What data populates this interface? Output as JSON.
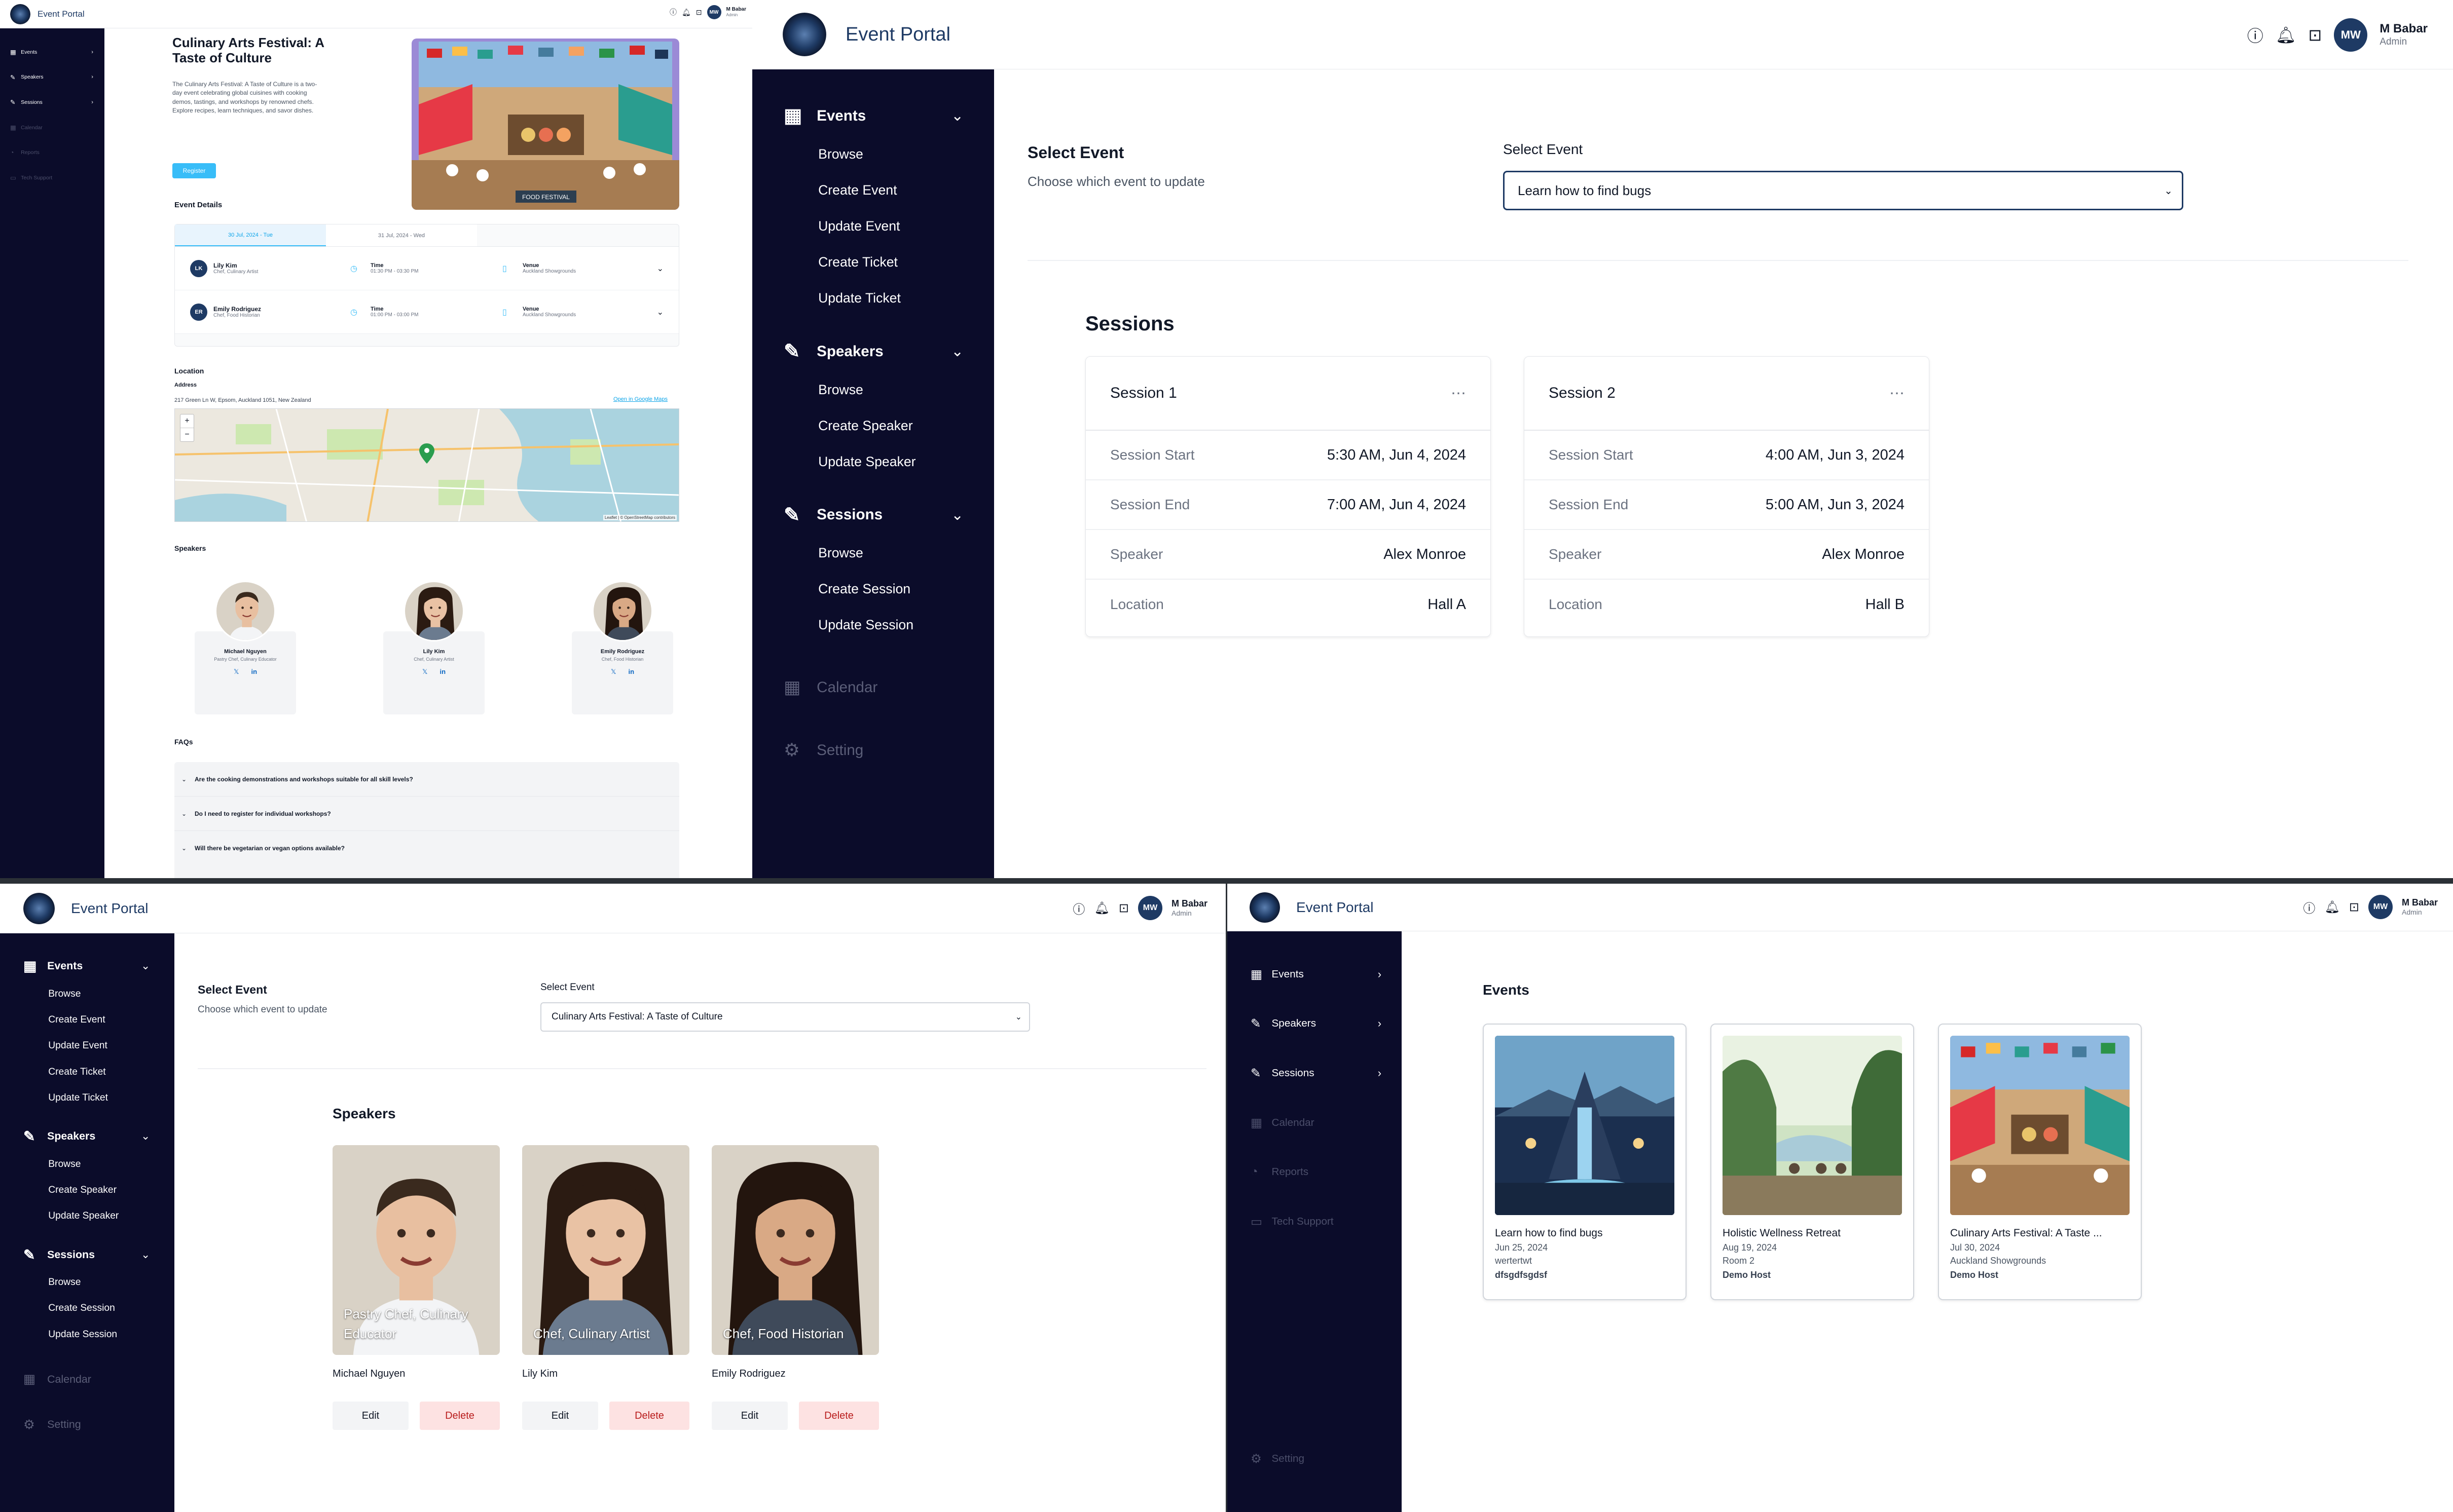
{
  "app": {
    "title": "Event Portal",
    "user_initials": "MW",
    "user_name": "M Babar",
    "user_role": "Admin"
  },
  "sidebar_collapsed": [
    {
      "label": "Events",
      "icon": "calendar-icon"
    },
    {
      "label": "Speakers",
      "icon": "pen-square-icon"
    },
    {
      "label": "Sessions",
      "icon": "pen-square-icon"
    },
    {
      "label": "Calendar",
      "icon": "calendar-icon",
      "disabled": true
    },
    {
      "label": "Reports",
      "icon": "pie-chart-icon",
      "disabled": true
    },
    {
      "label": "Tech Support",
      "icon": "chat-icon",
      "disabled": true
    }
  ],
  "sidebar_expanded": {
    "events": {
      "label": "Events",
      "items": [
        "Browse",
        "Create Event",
        "Update Event",
        "Create Ticket",
        "Update Ticket"
      ]
    },
    "speakers": {
      "label": "Speakers",
      "items": [
        "Browse",
        "Create Speaker",
        "Update Speaker"
      ]
    },
    "sessions": {
      "label": "Sessions",
      "items": [
        "Browse",
        "Create Session",
        "Update Session"
      ]
    },
    "calendar": "Calendar",
    "setting": "Setting"
  },
  "event_detail": {
    "title": "Culinary Arts Festival: A Taste of Culture",
    "description": "The Culinary Arts Festival: A Taste of Culture is a two-day event celebrating global cuisines with cooking demos, tastings, and workshops by renowned chefs. Explore recipes, learn techniques, and savor dishes.",
    "register": "Register",
    "details_heading": "Event Details",
    "date_tabs": [
      "30 Jul, 2024 - Tue",
      "31 Jul, 2024 - Wed"
    ],
    "sessions": [
      {
        "initials": "LK",
        "name": "Lily Kim",
        "role": "Chef, Culinary Artist",
        "time_label": "Time",
        "time": "01:30 PM - 03:30 PM",
        "venue_label": "Venue",
        "venue": "Auckland Showgrounds"
      },
      {
        "initials": "ER",
        "name": "Emily Rodriguez",
        "role": "Chef, Food Historian",
        "time_label": "Time",
        "time": "01:00 PM - 03:00 PM",
        "venue_label": "Venue",
        "venue": "Auckland Showgrounds"
      }
    ],
    "location_heading": "Location",
    "address_label": "Address",
    "address": "217 Green Ln W, Epsom, Auckland 1051, New Zealand",
    "maps_link": "Open in Google Maps",
    "map_credit": "Leaflet | © OpenStreetMap contributors",
    "zoom_in": "+",
    "zoom_out": "−",
    "speakers_heading": "Speakers",
    "speakers": [
      {
        "name": "Michael Nguyen",
        "role": "Pastry Chef, Culinary Educator"
      },
      {
        "name": "Lily Kim",
        "role": "Chef, Culinary Artist"
      },
      {
        "name": "Emily Rodriguez",
        "role": "Chef, Food Historian"
      }
    ],
    "faq_heading": "FAQs",
    "faqs": [
      "Are the cooking demonstrations and workshops suitable for all skill levels?",
      "Do I need to register for individual workshops?",
      "Will there be vegetarian or vegan options available?"
    ],
    "banner_text": "FOOD FESTIVAL"
  },
  "update_session": {
    "select_title": "Select Event",
    "select_sub": "Choose which event to update",
    "select_label": "Select Event",
    "selected_value": "Learn how to find bugs",
    "sessions_heading": "Sessions",
    "sessions": [
      {
        "title": "Session 1",
        "start_label": "Session Start",
        "start": "5:30 AM, Jun 4, 2024",
        "end_label": "Session End",
        "end": "7:00 AM, Jun 4, 2024",
        "speaker_label": "Speaker",
        "speaker": "Alex Monroe",
        "location_label": "Location",
        "location": "Hall A"
      },
      {
        "title": "Session 2",
        "start_label": "Session Start",
        "start": "4:00 AM, Jun 3, 2024",
        "end_label": "Session End",
        "end": "5:00 AM, Jun 3, 2024",
        "speaker_label": "Speaker",
        "speaker": "Alex Monroe",
        "location_label": "Location",
        "location": "Hall B"
      }
    ]
  },
  "update_speaker": {
    "select_title": "Select Event",
    "select_sub": "Choose which event to update",
    "select_label": "Select Event",
    "selected_value": "Culinary Arts Festival: A Taste of Culture",
    "speakers_heading": "Speakers",
    "speakers": [
      {
        "overlay": "Pastry Chef, Culinary Educator",
        "name": "Michael Nguyen"
      },
      {
        "overlay": "Chef, Culinary Artist",
        "name": "Lily Kim"
      },
      {
        "overlay": "Chef, Food Historian",
        "name": "Emily Rodriguez"
      }
    ],
    "edit": "Edit",
    "delete": "Delete"
  },
  "events_browse": {
    "heading": "Events",
    "events": [
      {
        "title": "Learn how to find bugs",
        "date": "Jun 25, 2024",
        "venue": "wertertwt",
        "host": "dfsgdfsgdsf"
      },
      {
        "title": "Holistic Wellness Retreat",
        "date": "Aug 19, 2024",
        "venue": "Room 2",
        "host": "Demo Host"
      },
      {
        "title": "Culinary Arts Festival: A Taste ...",
        "date": "Jul 30, 2024",
        "venue": "Auckland Showgrounds",
        "host": "Demo Host"
      }
    ]
  },
  "colors": {
    "navy": "#0b0c2a",
    "brand": "#1e3a64",
    "accent": "#38bdf8",
    "danger_bg": "#fde2e2",
    "danger_text": "#b91c1c"
  }
}
